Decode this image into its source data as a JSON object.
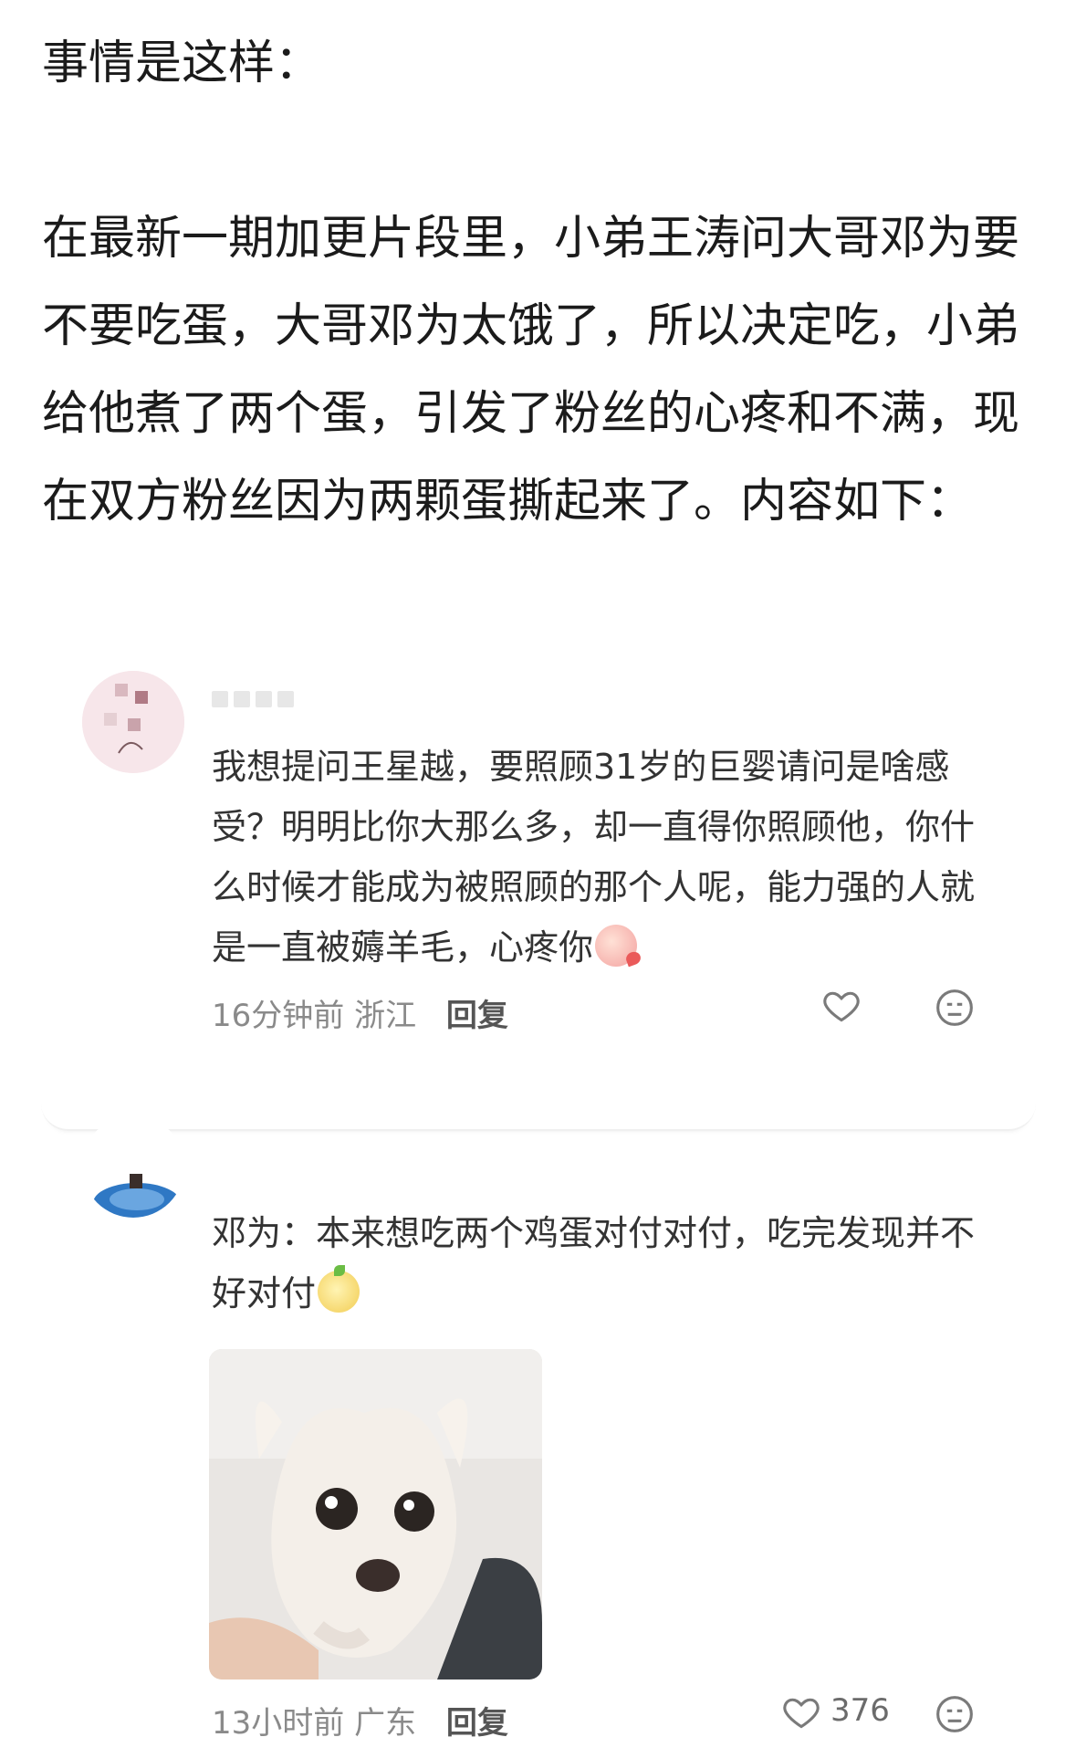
{
  "intro": {
    "title": "事情是这样：",
    "paragraph": "在最新一期加更片段里，小弟王涛问大哥邓为要不要吃蛋，大哥邓为太饿了，所以决定吃，小弟给他煮了两个蛋，引发了粉丝的心疼和不满，现在双方粉丝因为两颗蛋撕起来了。内容如下："
  },
  "comments": [
    {
      "text": "我想提问王星越，要照顾31岁的巨婴请问是啥感受？明明比你大那么多，却一直得你照顾他，你什么时候才能成为被照顾的那个人呢，能力强的人就是一直被薅羊毛，心疼你",
      "emoji_icon": "peach-emoji-icon",
      "time": "16分钟前",
      "location": "浙江",
      "reply_label": "回复",
      "like_count": ""
    },
    {
      "text": "邓为：本来想吃两个鸡蛋对付对付，吃完发现并不好对付",
      "emoji_icon": "chick-emoji-icon",
      "time": "13小时前",
      "location": "广东",
      "reply_label": "回复",
      "like_count": "376"
    }
  ],
  "colors": {
    "text_main": "#1b1b1b",
    "text_comment": "#333333",
    "meta_gray": "#8a8a8a"
  }
}
